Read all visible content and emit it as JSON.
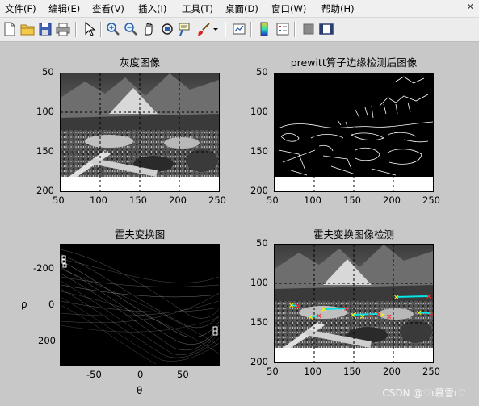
{
  "menu": {
    "items": [
      "文件(F)",
      "编辑(E)",
      "查看(V)",
      "插入(I)",
      "工具(T)",
      "桌面(D)",
      "窗口(W)",
      "帮助(H)"
    ],
    "close_glyph": "✕"
  },
  "toolbar": {
    "icons": [
      "new-figure-icon",
      "open-icon",
      "save-icon",
      "print-icon",
      "pointer-icon",
      "zoom-in-icon",
      "zoom-out-icon",
      "pan-icon",
      "rotate-3d-icon",
      "data-cursor-icon",
      "brush-icon",
      "brush-dropdown-icon",
      "link-plot-icon",
      "colorbar-icon",
      "legend-icon",
      "hide-plot-tools-icon",
      "show-plot-tools-icon"
    ]
  },
  "plots": {
    "p1": {
      "title": "灰度图像",
      "xticks": [
        "50",
        "100",
        "150",
        "200",
        "250"
      ],
      "yticks": [
        "50",
        "100",
        "150",
        "200"
      ]
    },
    "p2": {
      "title": "prewitt算子边缘检测后图像",
      "xticks": [
        "50",
        "100",
        "150",
        "200",
        "250"
      ],
      "yticks": [
        "50",
        "100",
        "150",
        "200"
      ]
    },
    "p3": {
      "title": "霍夫变换图",
      "xticks": [
        "-50",
        "0",
        "50"
      ],
      "yticks": [
        "-200",
        "0",
        "200"
      ],
      "xlabel": "θ",
      "ylabel": "ρ"
    },
    "p4": {
      "title": "霍夫变换图像检测",
      "xticks": [
        "50",
        "100",
        "150",
        "200",
        "250"
      ],
      "yticks": [
        "50",
        "100",
        "150",
        "200"
      ]
    }
  },
  "watermark": "CSDN @♡ι慕雪ι♡",
  "colors": {
    "background": "#c8c8c8",
    "detected_line": "#00e5e5",
    "marker_start": "#ffee00",
    "marker_end": "#ff2a2a"
  }
}
